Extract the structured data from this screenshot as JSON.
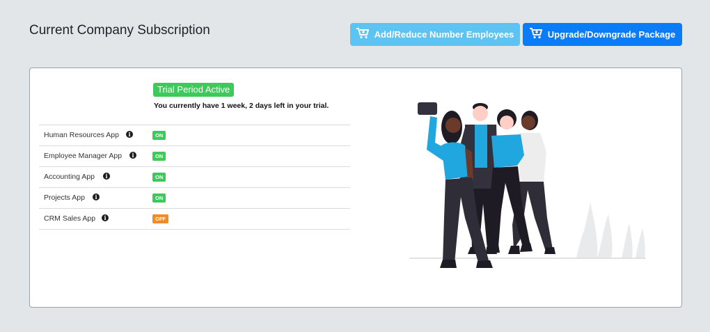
{
  "header": {
    "title": "Current Company Subscription",
    "add_reduce_label": "Add/Reduce Number Employees",
    "upgrade_label": "Upgrade/Downgrade Package"
  },
  "trial": {
    "badge": "Trial Period Active",
    "message": "You currently have 1 week, 2 days left in your trial."
  },
  "apps": [
    {
      "name": "Human Resources App",
      "status": "ON"
    },
    {
      "name": "Employee Manager App",
      "status": "ON"
    },
    {
      "name": "Accounting App",
      "status": "ON"
    },
    {
      "name": "Projects App",
      "status": "ON"
    },
    {
      "name": "CRM Sales App",
      "status": "OFF"
    }
  ],
  "colors": {
    "button_light": "#5cc3f3",
    "button_dark": "#0a7cf8",
    "status_on": "#3fc95a",
    "status_off": "#f38b22"
  },
  "icons": {
    "cart": "cart-icon",
    "info": "info-icon"
  }
}
